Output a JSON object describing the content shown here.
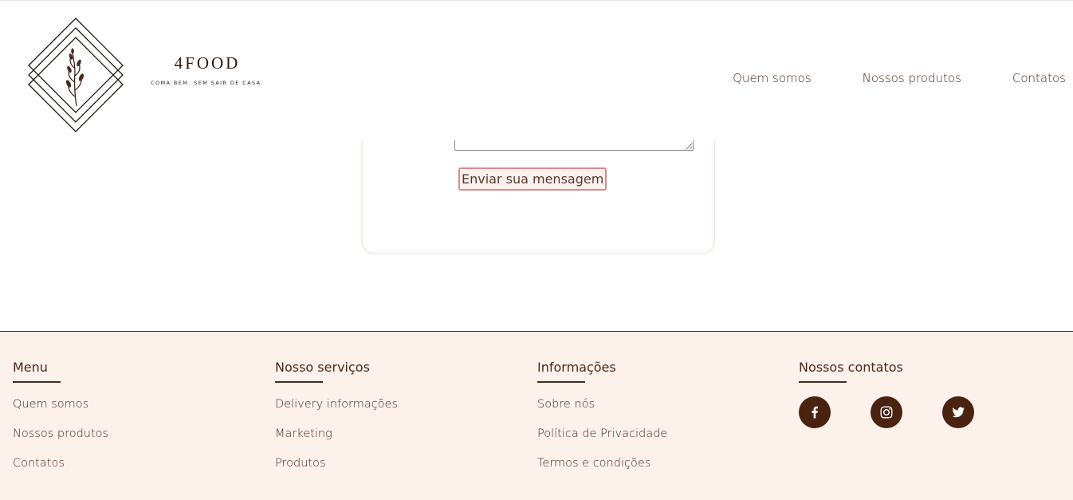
{
  "brand": {
    "name": "4FOOD",
    "tagline": "COMA BEM. SEM SAIR DE CASA."
  },
  "nav": [
    "Quem somos",
    "Nossos produtos",
    "Contatos"
  ],
  "form": {
    "submit_label": "Enviar sua mensagem",
    "message_value": ""
  },
  "footer": {
    "columns": [
      {
        "title": "Menu",
        "links": [
          "Quem somos",
          "Nossos produtos",
          "Contatos"
        ]
      },
      {
        "title": "Nosso serviços",
        "links": [
          "Delivery informações",
          "Marketing",
          "Produtos"
        ]
      },
      {
        "title": "Informações",
        "links": [
          "Sobre nós",
          "Política de Privacidade",
          "Termos e condições"
        ]
      },
      {
        "title": "Nossos contatos",
        "links": []
      }
    ],
    "socials": [
      "facebook-icon",
      "instagram-icon",
      "twitter-icon"
    ]
  },
  "colors": {
    "brand_brown": "#4b2a18",
    "footer_bg": "#fdf1ec",
    "card_border": "#fde8e4",
    "button_border": "#d98a88"
  }
}
